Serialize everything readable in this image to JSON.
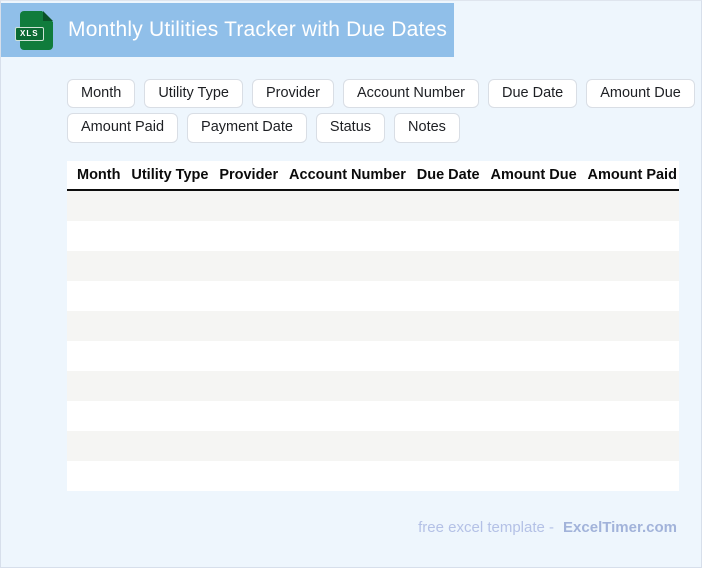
{
  "header": {
    "title": "Monthly Utilities Tracker with Due Dates",
    "file_badge": "XLS",
    "bar_color": "#90bfe9",
    "icon_green": "#107c3c"
  },
  "chips": {
    "row1": [
      "Month",
      "Utility Type",
      "Provider",
      "Account Number",
      "Due Date",
      "Amount Due"
    ],
    "row2": [
      "Amount Paid",
      "Payment Date",
      "Status",
      "Notes"
    ]
  },
  "table": {
    "columns": [
      "Month",
      "Utility Type",
      "Provider",
      "Account Number",
      "Due Date",
      "Amount Due",
      "Amount Paid"
    ],
    "empty_row_count": 10,
    "stripe_color": "#f5f5f3",
    "header_rule_color": "#0d0d0d"
  },
  "footer": {
    "prefix": "free excel template -",
    "brand": "ExcelTimer.com"
  },
  "page": {
    "background": "#eef6fd",
    "border_color": "#d7dfeb"
  }
}
